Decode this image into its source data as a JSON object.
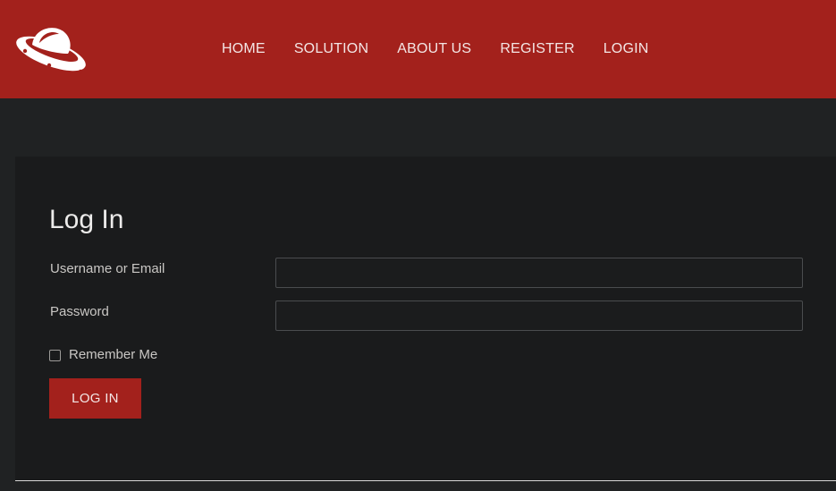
{
  "header": {
    "nav": [
      {
        "label": "HOME"
      },
      {
        "label": "SOLUTION"
      },
      {
        "label": "ABOUT US"
      },
      {
        "label": "REGISTER"
      },
      {
        "label": "LOGIN"
      }
    ],
    "logo_icon": "ufo-saucer-icon"
  },
  "form": {
    "title": "Log In",
    "username_label": "Username or Email",
    "username_value": "",
    "password_label": "Password",
    "password_value": "",
    "remember_label": "Remember Me",
    "remember_checked": false,
    "submit_label": "LOG IN"
  },
  "colors": {
    "brand_red": "#a3211c",
    "page_bg": "#202223",
    "panel_bg": "#1a1b1c"
  }
}
